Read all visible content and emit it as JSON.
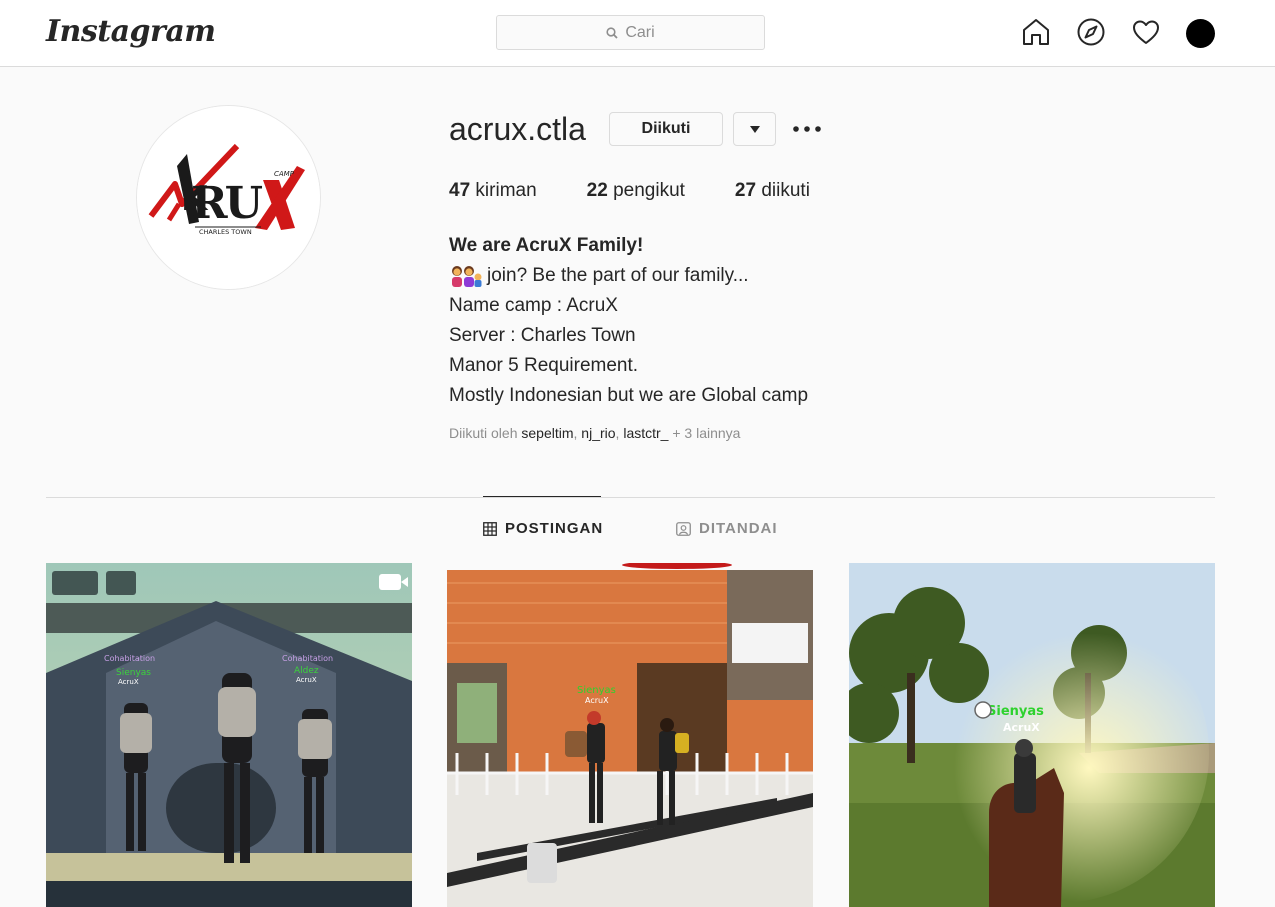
{
  "header": {
    "logo": "Instagram",
    "search_placeholder": "Cari",
    "icons": [
      "home-icon",
      "explore-icon",
      "heart-icon",
      "profile-avatar"
    ]
  },
  "profile": {
    "username": "acrux.ctla",
    "follow_button": "Diikuti",
    "avatar_logo": {
      "main": "ACRUX",
      "small_top": "CAMP",
      "small_bottom": "CHARLES TOWN"
    },
    "stats": {
      "posts_count": "47",
      "posts_label": "kiriman",
      "followers_count": "22",
      "followers_label": "pengikut",
      "following_count": "27",
      "following_label": "diikuti"
    },
    "bio": {
      "name": "We are AcruX Family!",
      "line1": "join? Be the part of our family...",
      "line2": "Name camp : AcruX",
      "line3": "Server : Charles Town",
      "line4": "Manor 5 Requirement.",
      "line5": "Mostly Indonesian but we are Global camp"
    },
    "followed_by": {
      "prefix": "Diikuti oleh",
      "users": [
        "sepeltim",
        "nj_rio",
        "lastctr_"
      ],
      "suffix": "+ 3 lainnya"
    }
  },
  "tabs": [
    {
      "label": "POSTINGAN",
      "active": true
    },
    {
      "label": "DITANDAI",
      "active": false
    }
  ],
  "posts": [
    {
      "type": "video",
      "labels": [
        "Cohabitation",
        "Sienyas",
        "AcruX",
        "Cohabitation",
        "Aldez",
        "AcruX"
      ]
    },
    {
      "type": "image",
      "labels": [
        "Sienyas",
        "AcruX"
      ]
    },
    {
      "type": "image",
      "labels": [
        "Sienyas",
        "AcruX"
      ]
    }
  ],
  "colors": {
    "background": "#fafafa",
    "border": "#dbdbdb",
    "text": "#262626",
    "muted": "#8e8e8e",
    "logo_red": "#d01818"
  }
}
